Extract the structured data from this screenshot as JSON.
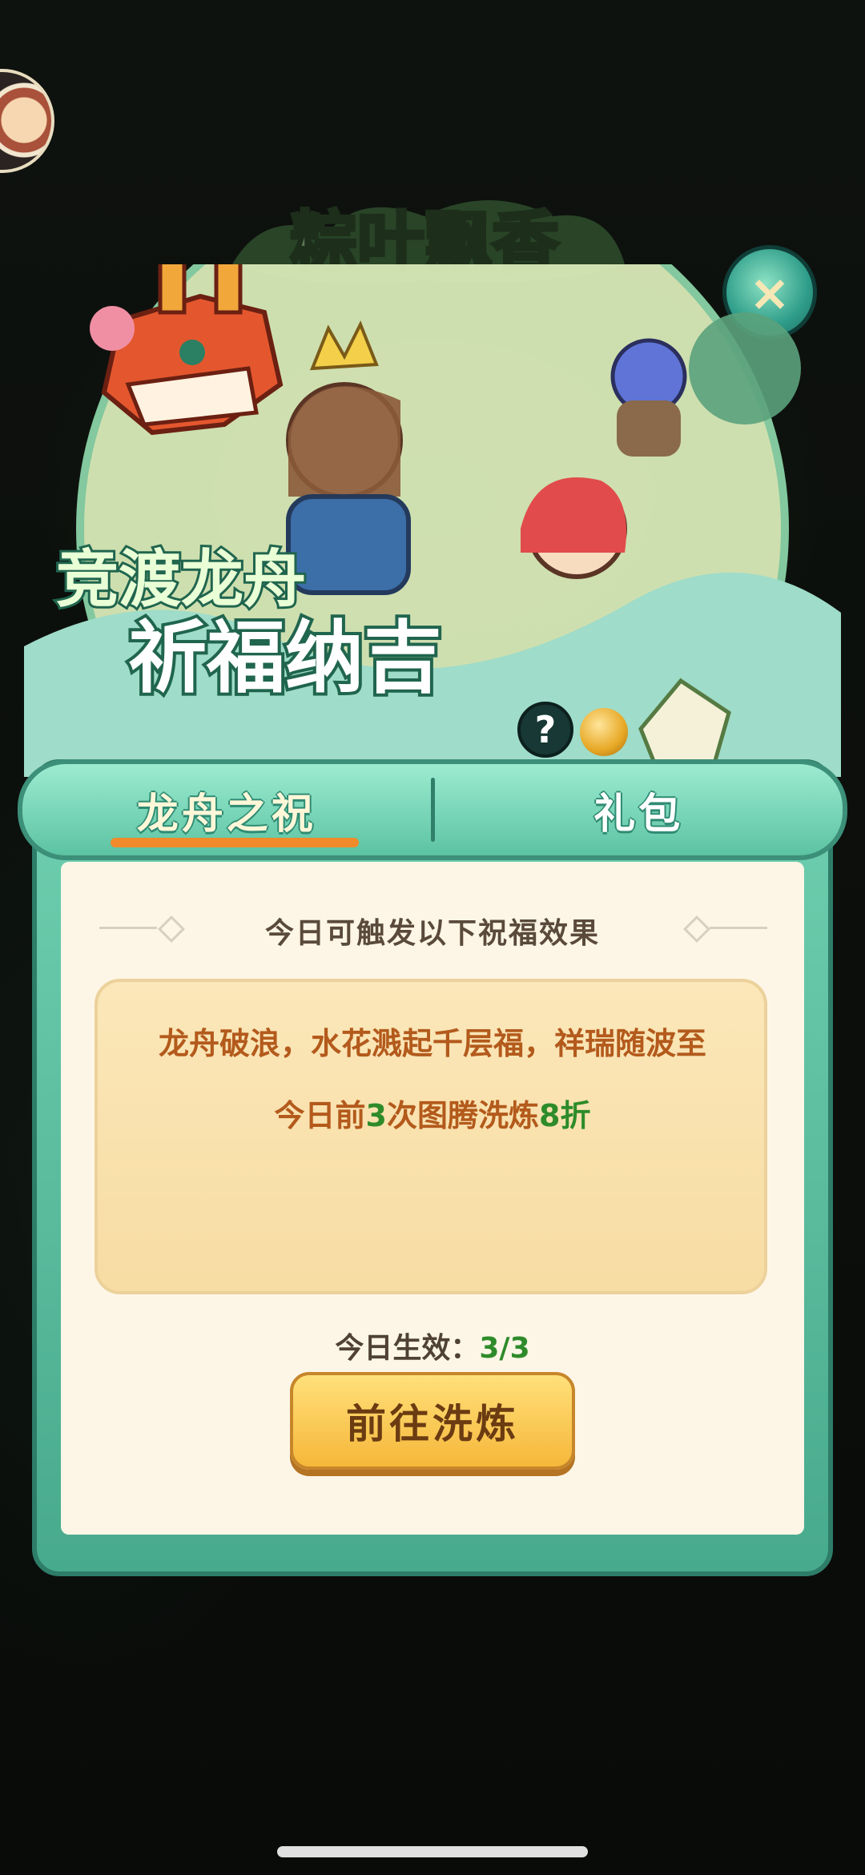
{
  "header": {
    "title_art": "粽叶飘香",
    "banner_line1": "竞渡龙舟",
    "banner_line2": "祈福纳吉",
    "help_symbol": "?",
    "close_symbol": "×"
  },
  "tabs": [
    {
      "label": "龙舟之祝",
      "active": true
    },
    {
      "label": "礼包",
      "active": false
    }
  ],
  "content": {
    "subtitle": "今日可触发以下祝福效果",
    "blessing": "龙舟破浪，水花溅起千层福，祥瑞随波至",
    "effect": {
      "prefix": "今日前",
      "count": "3",
      "middle": "次图腾洗炼",
      "discount": "8折"
    },
    "status_label": "今日生效：",
    "status_value": "3/3",
    "action_label": "前往洗炼"
  },
  "colors": {
    "accent_green": "#2e8b2a",
    "accent_orange": "#b35a1c",
    "panel_teal": "#48aa8c",
    "button_gold": "#f6b73a"
  }
}
